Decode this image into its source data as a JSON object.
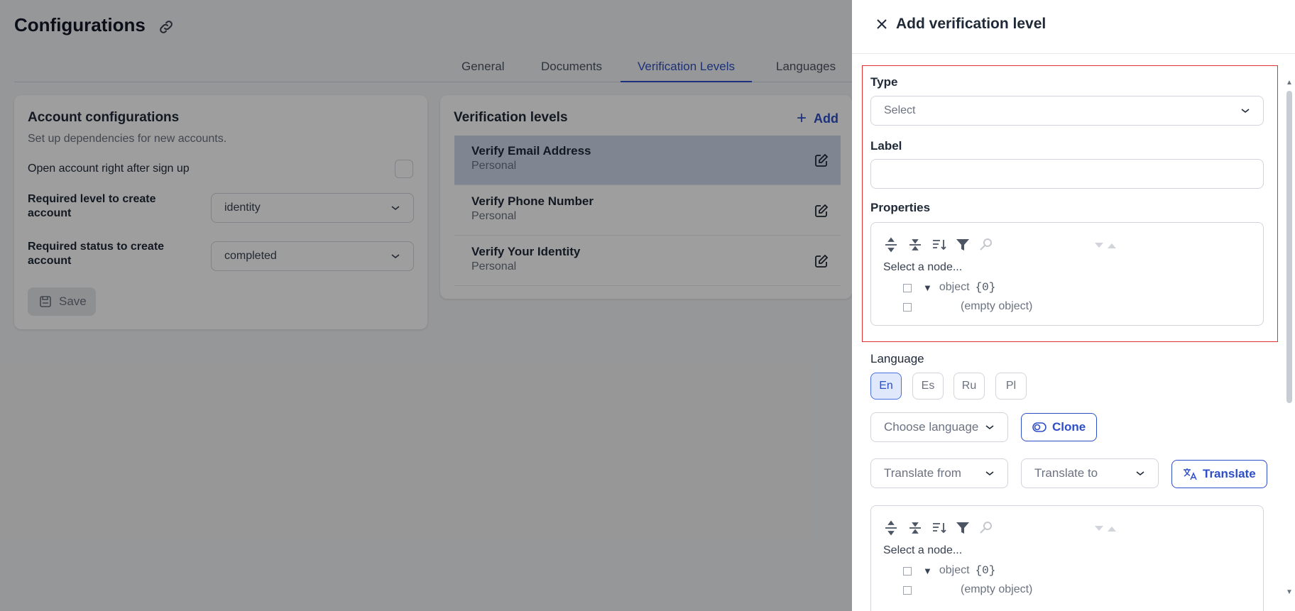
{
  "page": {
    "title": "Configurations",
    "tabs": [
      "General",
      "Documents",
      "Verification Levels",
      "Languages"
    ],
    "active_tab": "Verification Levels"
  },
  "account_config": {
    "title": "Account configurations",
    "subtitle": "Set up dependencies for new accounts.",
    "open_account_label": "Open account right  after sign up",
    "required_level_label": "Required level to create account",
    "required_level_value": "identity",
    "required_status_label": "Required status to create account",
    "required_status_value": "completed",
    "save_label": "Save"
  },
  "verification_levels": {
    "title": "Verification levels",
    "add_label": "Add",
    "items": [
      {
        "name": "Verify Email Address",
        "type": "Personal"
      },
      {
        "name": "Verify Phone Number",
        "type": "Personal"
      },
      {
        "name": "Verify Your Identity",
        "type": "Personal"
      }
    ]
  },
  "panel": {
    "title": "Add verification level",
    "type_label": "Type",
    "type_placeholder": "Select",
    "label_label": "Label",
    "label_value": "",
    "properties_label": "Properties",
    "json_hint": "Select a node...",
    "json_object": "object",
    "json_count": "{0}",
    "json_empty": "(empty object)",
    "language_label": "Language",
    "languages": [
      "En",
      "Es",
      "Ru",
      "Pl"
    ],
    "active_language": "En",
    "choose_language": "Choose language",
    "clone_label": "Clone",
    "translate_from": "Translate from",
    "translate_to": "Translate to",
    "translate_label": "Translate"
  },
  "colors": {
    "accent": "#2e4ec7",
    "highlight_border": "#e03131",
    "selected_row": "#cfd8ea"
  }
}
